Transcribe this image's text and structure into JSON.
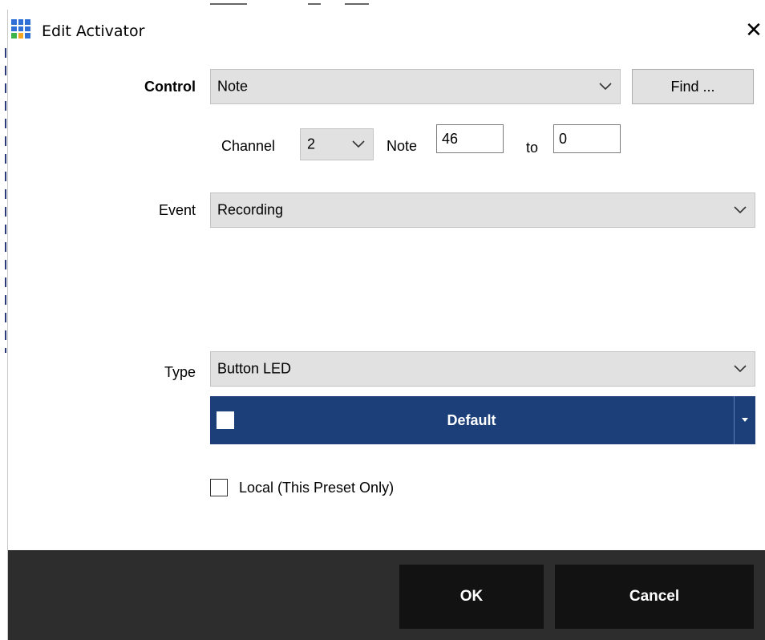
{
  "window": {
    "title": "Edit Activator"
  },
  "control": {
    "label": "Control",
    "value": "Note",
    "find_label": "Find ..."
  },
  "midi": {
    "channel_label": "Channel",
    "channel_value": "2",
    "note_label": "Note",
    "note_value": "46",
    "to_label": "to",
    "to_value": "0"
  },
  "event": {
    "label": "Event",
    "value": "Recording"
  },
  "type": {
    "label": "Type",
    "value": "Button LED"
  },
  "color": {
    "label": "Default",
    "accent": "#1c3f7a",
    "swatch": "#ffffff"
  },
  "local": {
    "label": "Local (This Preset Only)",
    "checked": false
  },
  "footer": {
    "ok_label": "OK",
    "cancel_label": "Cancel"
  }
}
